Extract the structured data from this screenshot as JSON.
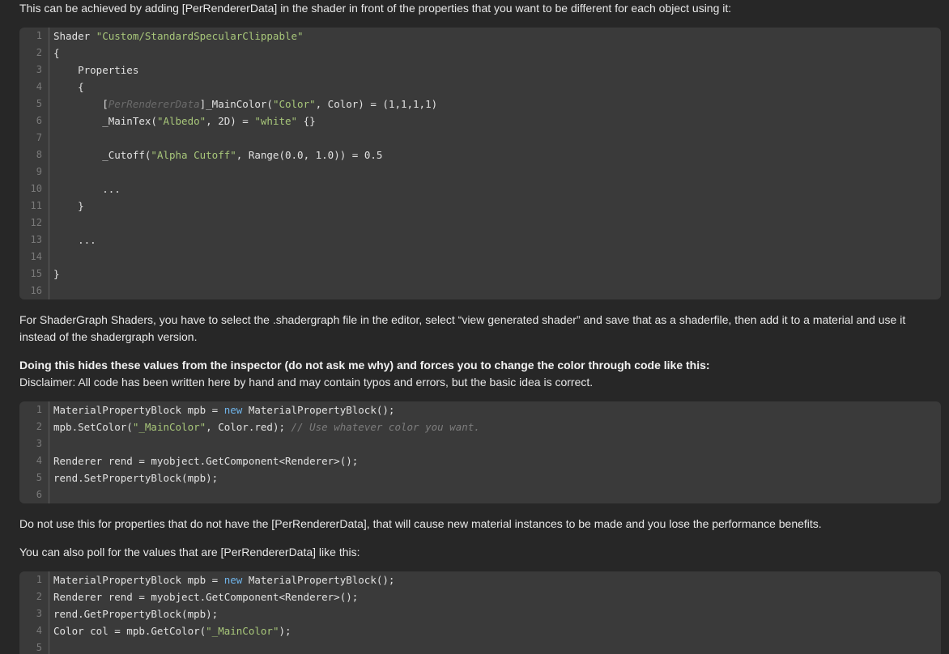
{
  "intro": "This can be achieved by adding [PerRendererData] in the shader in front of the properties that you want to be different for each object using it:",
  "code1": {
    "line_numbers": [
      "1",
      "2",
      "3",
      "4",
      "5",
      "6",
      "7",
      "8",
      "9",
      "10",
      "11",
      "12",
      "13",
      "14",
      "15",
      "16"
    ],
    "lines": [
      {
        "plain": "Shader ",
        "str": "\"Custom/StandardSpecularClippable\""
      },
      {
        "plain": "{"
      },
      {
        "plain": "    Properties"
      },
      {
        "plain": "    {"
      },
      {
        "p1": "        [",
        "dim": "PerRendererData",
        "p2": "]_MainColor(",
        "s1": "\"Color\"",
        "p3": ", Color) = (1,1,1,1)"
      },
      {
        "p1": "        _MainTex(",
        "s1": "\"Albedo\"",
        "p2": ", 2D) = ",
        "s2": "\"white\"",
        "p3": " {}"
      },
      {
        "plain": ""
      },
      {
        "p1": "        _Cutoff(",
        "s1": "\"Alpha Cutoff\"",
        "p2": ", Range(0.0, 1.0)) = 0.5"
      },
      {
        "plain": ""
      },
      {
        "plain": "        ..."
      },
      {
        "plain": "    }"
      },
      {
        "plain": ""
      },
      {
        "plain": "    ..."
      },
      {
        "plain": ""
      },
      {
        "plain": "}"
      },
      {
        "plain": ""
      }
    ]
  },
  "para_shadergraph": "For ShaderGraph Shaders, you have to select the .shadergraph file in the editor, select “view generated shader” and save that as a shaderfile, then add it to a material and use it instead of the shadergraph version.",
  "para_bold": "Doing this hides these values from the inspector (do not ask me why) and forces you to change the color through code like this:",
  "para_disclaimer": "Disclaimer: All code has been written here by hand and may contain typos and errors, but the basic idea is correct.",
  "code2": {
    "line_numbers": [
      "1",
      "2",
      "3",
      "4",
      "5",
      "6"
    ],
    "lines": [
      {
        "p1": "MaterialPropertyBlock mpb = ",
        "kw": "new",
        "p2": " MaterialPropertyBlock();"
      },
      {
        "p1": "mpb.SetColor(",
        "s1": "\"_MainColor\"",
        "p2": ", Color.red); ",
        "cm": "// Use whatever color you want."
      },
      {
        "plain": ""
      },
      {
        "plain": "Renderer rend = myobject.GetComponent<Renderer>();"
      },
      {
        "plain": "rend.SetPropertyBlock(mpb);"
      },
      {
        "plain": ""
      }
    ]
  },
  "para_warning": "Do not use this for properties that do not have the [PerRendererData], that will cause new material instances to be made and you lose the performance benefits.",
  "para_poll": "You can also poll for the values that are [PerRendererData] like this:",
  "code3": {
    "line_numbers": [
      "1",
      "2",
      "3",
      "4",
      "5"
    ],
    "lines": [
      {
        "p1": "MaterialPropertyBlock mpb = ",
        "kw": "new",
        "p2": " MaterialPropertyBlock();"
      },
      {
        "plain": "Renderer rend = myobject.GetComponent<Renderer>();"
      },
      {
        "plain": "rend.GetPropertyBlock(mpb);"
      },
      {
        "p1": "Color col = mpb.GetColor(",
        "s1": "\"_MainColor\"",
        "p2": ");"
      },
      {
        "plain": ""
      }
    ]
  }
}
